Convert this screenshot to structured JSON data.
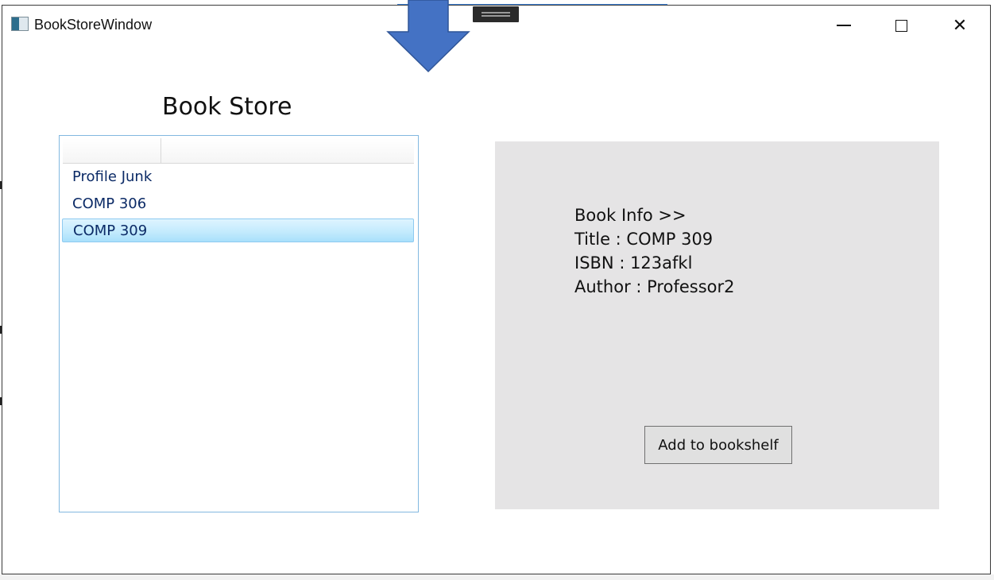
{
  "window": {
    "title": "BookStoreWindow",
    "controls": {
      "minimize": "–",
      "maximize": "□",
      "close": "✕"
    }
  },
  "heading": "Book Store",
  "book_list": {
    "items": [
      {
        "label": "Profile Junk",
        "selected": false
      },
      {
        "label": "COMP 306",
        "selected": false
      },
      {
        "label": "COMP 309",
        "selected": true
      }
    ]
  },
  "book_info": {
    "header": "Book Info >>",
    "title_line": "Title : COMP 309",
    "isbn_line": "ISBN : 123afkl",
    "author_line": "Author : Professor2"
  },
  "actions": {
    "add_to_bookshelf": "Add to bookshelf"
  },
  "colors": {
    "panel_bg": "#e5e4e5",
    "selection": "#c4ebfd",
    "arrow": "#4472c4",
    "list_text": "#0b2a66"
  },
  "icons": [
    "app-window-icon",
    "down-arrow-icon",
    "drag-handle-icon",
    "minimize-icon",
    "maximize-icon",
    "close-icon"
  ]
}
